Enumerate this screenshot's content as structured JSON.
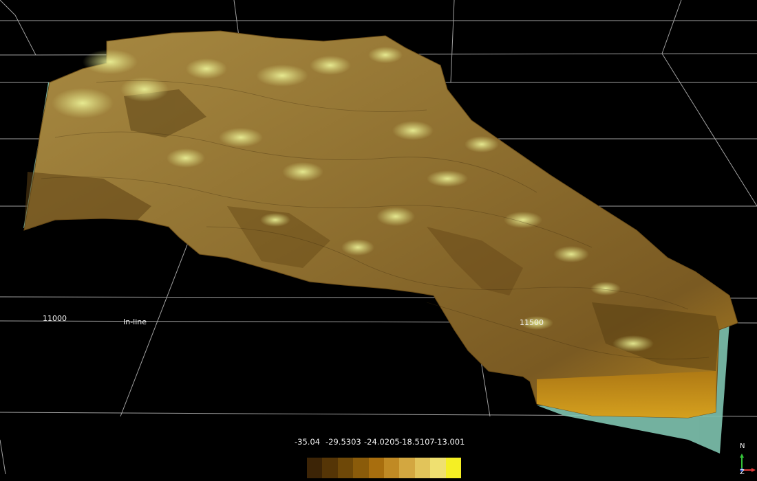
{
  "viewport": {
    "axes": {
      "inline_label": "In-line",
      "inline_ticks": [
        "11000",
        "11500"
      ]
    },
    "surface_colors": {
      "dark": "#4a3410",
      "mid": "#8a6a2c",
      "light": "#bfa45a",
      "highlight": "#e4e888",
      "edge": "#7fc4b0"
    }
  },
  "colorbar": {
    "ticks": [
      "-35.04",
      "-29.5303",
      "-24.0205",
      "-18.5107",
      "-13.001"
    ],
    "swatches": [
      "#3c2406",
      "#553506",
      "#6e4808",
      "#8a5b0a",
      "#a86e0e",
      "#c08a24",
      "#d3a740",
      "#e2c45a",
      "#efe070",
      "#f5ef24"
    ]
  },
  "compass": {
    "north": "N",
    "z": "Z"
  }
}
